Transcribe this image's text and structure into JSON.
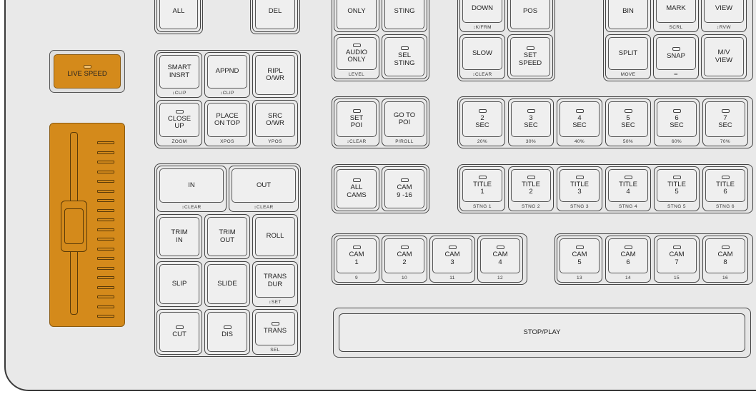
{
  "live_speed": {
    "label": "LIVE SPEED"
  },
  "top_row": [
    {
      "label": "ALL"
    },
    {
      "label": "DEL"
    },
    {
      "label": "ONLY"
    },
    {
      "label": "STING"
    },
    {
      "label": "DOWN",
      "sub": "↕K/FRM"
    },
    {
      "label": "POS"
    },
    {
      "label": "BIN"
    },
    {
      "label": "MARK",
      "sub": "SCRL"
    },
    {
      "label": "VIEW",
      "sub": "↕RVW"
    }
  ],
  "edit_keys": [
    {
      "label": "SMART\nINSRT",
      "sub": "↕CLIP"
    },
    {
      "label": "APPND",
      "sub": "↕CLIP"
    },
    {
      "label": "RIPL\nO/WR"
    },
    {
      "label": "CLOSE\nUP",
      "sub": "ZOOM"
    },
    {
      "label": "PLACE\nON TOP",
      "sub": "XPOS"
    },
    {
      "label": "SRC\nO/WR",
      "sub": "YPOS"
    }
  ],
  "in_out": [
    {
      "label": "IN",
      "sub": "↕CLEAR"
    },
    {
      "label": "OUT",
      "sub": "↕CLEAR"
    }
  ],
  "trim_keys": [
    {
      "label": "TRIM\nIN"
    },
    {
      "label": "TRIM\nOUT"
    },
    {
      "label": "ROLL"
    },
    {
      "label": "SLIP"
    },
    {
      "label": "SLIDE"
    },
    {
      "label": "TRANS\nDUR",
      "sub": "↕SET"
    },
    {
      "label": "CUT"
    },
    {
      "label": "DIS"
    },
    {
      "label": "TRANS",
      "sub": "SEL"
    }
  ],
  "audio_keys": [
    {
      "label": "AUDIO\nONLY",
      "sub": "LEVEL"
    },
    {
      "label": "SEL\nSTING"
    }
  ],
  "speed_keys": [
    {
      "label": "SLOW",
      "sub": "↕CLEAR"
    },
    {
      "label": "SET\nSPEED"
    }
  ],
  "view_keys": [
    {
      "label": "SPLIT",
      "sub": "MOVE"
    },
    {
      "label": "SNAP",
      "sub": "═"
    },
    {
      "label": "M/V\nVIEW"
    }
  ],
  "poi_keys": [
    {
      "label": "SET\nPOI",
      "sub": "↕CLEAR"
    },
    {
      "label": "GO TO\nPOI",
      "sub": "P/ROLL"
    }
  ],
  "sec_keys": [
    {
      "label": "2\nSEC",
      "sub": "20%"
    },
    {
      "label": "3\nSEC",
      "sub": "30%"
    },
    {
      "label": "4\nSEC",
      "sub": "40%"
    },
    {
      "label": "5\nSEC",
      "sub": "50%"
    },
    {
      "label": "6\nSEC",
      "sub": "60%"
    },
    {
      "label": "7\nSEC",
      "sub": "70%"
    }
  ],
  "cams_keys": [
    {
      "label": "ALL\nCAMS"
    },
    {
      "label": "CAM\n9 -16"
    }
  ],
  "title_keys": [
    {
      "label": "TITLE\n1",
      "sub": "STNG 1"
    },
    {
      "label": "TITLE\n2",
      "sub": "STNG 2"
    },
    {
      "label": "TITLE\n3",
      "sub": "STNG 3"
    },
    {
      "label": "TITLE\n4",
      "sub": "STNG 4"
    },
    {
      "label": "TITLE\n5",
      "sub": "STNG 5"
    },
    {
      "label": "TITLE\n6",
      "sub": "STNG 6"
    }
  ],
  "cam_left": [
    {
      "label": "CAM\n1",
      "sub": "9"
    },
    {
      "label": "CAM\n2",
      "sub": "10"
    },
    {
      "label": "CAM\n3",
      "sub": "11"
    },
    {
      "label": "CAM\n4",
      "sub": "12"
    }
  ],
  "cam_right": [
    {
      "label": "CAM\n5",
      "sub": "13"
    },
    {
      "label": "CAM\n6",
      "sub": "14"
    },
    {
      "label": "CAM\n7",
      "sub": "15"
    },
    {
      "label": "CAM\n8",
      "sub": "16"
    }
  ],
  "stop_play": {
    "label": "STOP/PLAY"
  },
  "colors": {
    "accent": "#d48a1b",
    "panel": "#e9e9e9",
    "outline": "#444444"
  }
}
